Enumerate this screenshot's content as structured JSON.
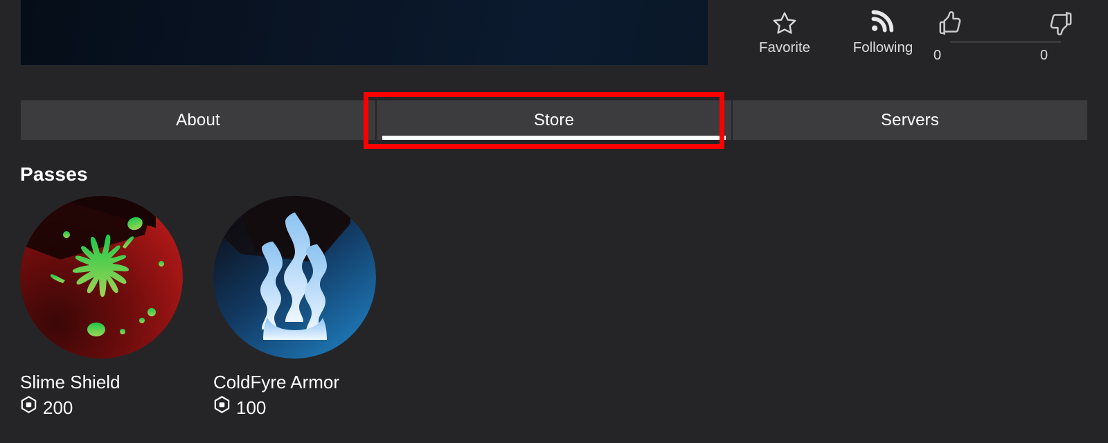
{
  "banner": {
    "name": "game-banner",
    "bg_color": "#0a1526"
  },
  "actions": {
    "favorite": {
      "label": "Favorite",
      "icon": "star-icon"
    },
    "follow": {
      "label": "Following",
      "icon": "rss-icon"
    },
    "votes": {
      "up_icon": "thumbs-up-icon",
      "down_icon": "thumbs-down-icon",
      "up_count": "0",
      "down_count": "0",
      "ratio_percent": 0
    }
  },
  "tabs": [
    {
      "label": "About",
      "active": false
    },
    {
      "label": "Store",
      "active": true
    },
    {
      "label": "Servers",
      "active": false
    }
  ],
  "highlight": {
    "target": "Store",
    "color": "#ff0000"
  },
  "store": {
    "section_title": "Passes",
    "passes": [
      {
        "name": "Slime Shield",
        "price": "200",
        "currency_icon": "robux-icon",
        "thumb": "slime-splatter-thumbnail",
        "colors": {
          "bg_dark": "#1d0404",
          "bg_mid": "#7a0d0d",
          "bg_bright": "#c01a1a",
          "art": "#5ec63a"
        }
      },
      {
        "name": "ColdFyre Armor",
        "price": "100",
        "currency_icon": "robux-icon",
        "thumb": "cold-flame-thumbnail",
        "colors": {
          "bg_dark": "#0e1420",
          "bg_mid": "#1b4a7a",
          "bg_bright": "#1d7fc4",
          "art": "#cfe6fb"
        }
      }
    ]
  },
  "theme": {
    "page_bg": "#252527",
    "tab_bg": "#3c3c3e",
    "text": "#ffffff"
  }
}
